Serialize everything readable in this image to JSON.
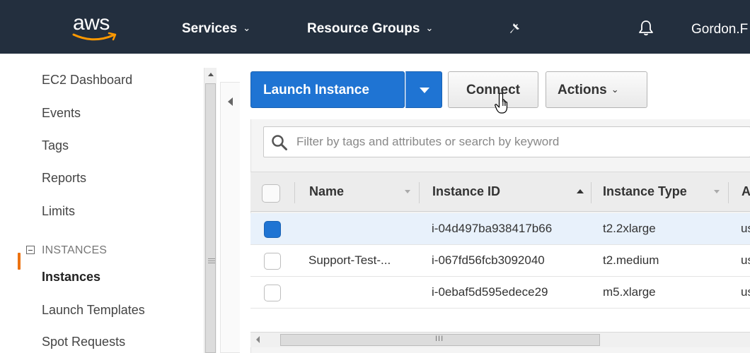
{
  "topnav": {
    "logo": "aws",
    "services": "Services",
    "resource_groups": "Resource Groups",
    "chevron": "⌄",
    "user": "Gordon.F",
    "icons": [
      "pin-icon",
      "bell-icon"
    ],
    "colors": {
      "background": "#232f3e",
      "logo_smile": "#ff9900"
    }
  },
  "sidebar": {
    "items": [
      {
        "label": "EC2 Dashboard"
      },
      {
        "label": "Events"
      },
      {
        "label": "Tags"
      },
      {
        "label": "Reports"
      },
      {
        "label": "Limits"
      }
    ],
    "section_instances": "INSTANCES",
    "instances_items": [
      {
        "label": "Instances",
        "active": true
      },
      {
        "label": "Launch Templates"
      },
      {
        "label": "Spot Requests"
      }
    ],
    "active_color": "#ec7211"
  },
  "toolbar": {
    "launch_label": "Launch Instance",
    "connect_label": "Connect",
    "actions_label": "Actions",
    "actions_chevron": "⌄",
    "primary_color": "#1f74d3"
  },
  "filter": {
    "placeholder": "Filter by tags and attributes or search by keyword",
    "value": ""
  },
  "table": {
    "columns": [
      "Name",
      "Instance ID",
      "Instance Type",
      "A"
    ],
    "rows": [
      {
        "selected": true,
        "name": "",
        "instance_id": "i-04d497ba938417b66",
        "instance_type": "t2.2xlarge",
        "az": "us"
      },
      {
        "selected": false,
        "name": "Support-Test-...",
        "instance_id": "i-067fd56fcb3092040",
        "instance_type": "t2.medium",
        "az": "us"
      },
      {
        "selected": false,
        "name": "",
        "instance_id": "i-0ebaf5d595edece29",
        "instance_type": "m5.xlarge",
        "az": "us"
      }
    ],
    "scroll_grip": "III"
  }
}
